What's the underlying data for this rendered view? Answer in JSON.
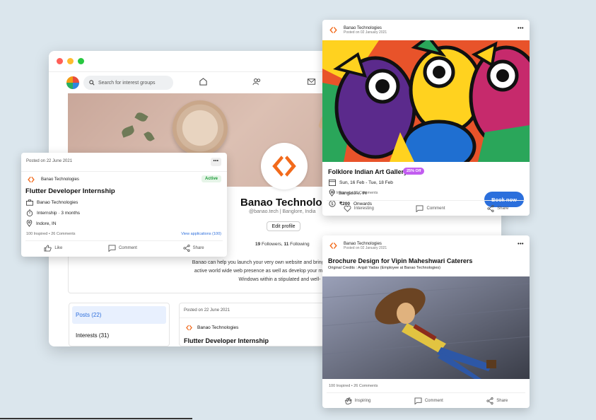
{
  "window": {
    "search": {
      "placeholder": "Search for interest groups"
    },
    "profile": {
      "name": "Banao Technologies",
      "handle": "@banao.tech | Banglore, India",
      "edit_label": "Edit profile",
      "followers_count": "19",
      "followers_label": "Followers,",
      "following_count": "11",
      "following_label": "Following",
      "about_lines": [
        "Banao can help you launch your very own website and bring y",
        "active world wide web presence as well as develop your mob",
        "Windows within a stipulated and well-"
      ],
      "see_more": "Se"
    },
    "sidebar": {
      "items": [
        {
          "label": "Posts (22)"
        },
        {
          "label": "Interests (31)"
        }
      ]
    },
    "feed": {
      "date": "Posted on 22 June 2021",
      "org": "Banao Technologies",
      "title": "Flutter Developer Internship"
    }
  },
  "job_card": {
    "date": "Posted on 22 June 2021",
    "more": "•••",
    "org": "Banao Technologies",
    "status": "Active",
    "title": "Flutter Developer Internship",
    "company": "Banao Technologies",
    "duration": "Internship · 3 months",
    "location": "Indore, IN",
    "stats": "100 Inspired • 26 Comments",
    "view_link": "View applications (100)",
    "actions": [
      "Like",
      "Comment",
      "Share"
    ]
  },
  "art_card": {
    "org": "Banao Technologies",
    "date": "Posted on 02 January 2021",
    "more": "•••",
    "title": "Folklore Indian Art Gallery",
    "offer": "25% Off",
    "dates": "Sun, 16 Feb - Tue, 18 Feb",
    "location": "Bangalore, IN",
    "price": "₹200",
    "price_suffix": "Onwards",
    "book_label": "Book now",
    "stats": "100 Inspired • 26 Comments",
    "actions": [
      "Interesting",
      "Comment",
      "Share"
    ]
  },
  "brochure_card": {
    "org": "Banao Technologies",
    "date": "Posted on 02 January 2021",
    "more": "•••",
    "title": "Brochure Design for Vipin Maheshwari Caterers",
    "credit": "Original Credits : Anjali Yadav (Employee at Banao Technologies)",
    "stats": "100 Inspired • 26 Comments",
    "actions": [
      "Inspiring",
      "Comment",
      "Share"
    ]
  },
  "colors": {
    "accent": "#2b6fdc",
    "brand_orange": "#f26a1b",
    "active_green": "#1e9c3a",
    "offer_purple": "#c25df0"
  }
}
